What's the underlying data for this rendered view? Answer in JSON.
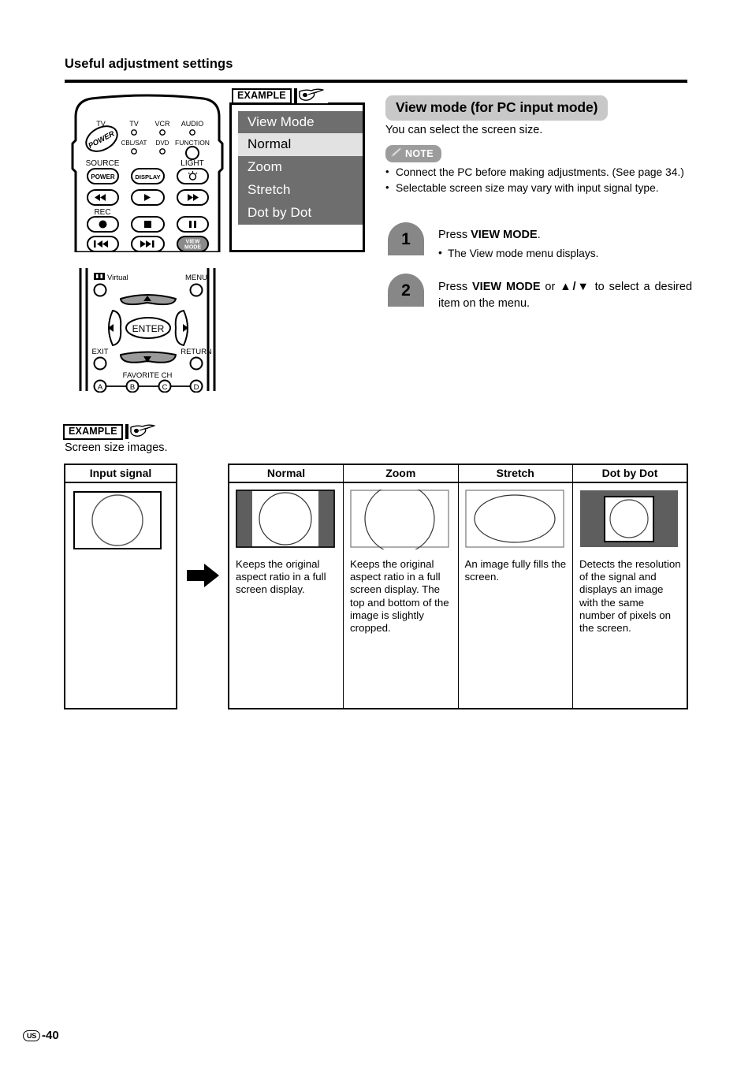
{
  "page": {
    "heading": "Useful adjustment settings",
    "footer_page": "-40",
    "footer_region": "US"
  },
  "example_top": {
    "label": "EXAMPLE",
    "icon": "pointing-hand-icon"
  },
  "view_mode_menu": {
    "title": "View Mode",
    "items": [
      {
        "label": "Normal",
        "selected": true
      },
      {
        "label": "Zoom",
        "selected": false
      },
      {
        "label": "Stretch",
        "selected": false
      },
      {
        "label": "Dot by Dot",
        "selected": false
      }
    ],
    "background_color": "#6e6e6e",
    "selected_color": "#e2e2e2"
  },
  "remote_top": {
    "labels": {
      "tv_power": "TV",
      "tv": "TV",
      "vcr": "VCR",
      "audio": "AUDIO",
      "cbl_sat": "CBL/SAT",
      "dvd": "DVD",
      "function": "FUNCTION",
      "source": "SOURCE",
      "light": "LIGHT",
      "rec": "REC",
      "power_button": "POWER",
      "display_button": "DISPLAY",
      "view_mode_button_line1": "VIEW",
      "view_mode_button_line2": "MODE",
      "power_dial": "POWER"
    }
  },
  "remote_bottom": {
    "labels": {
      "virtual": "Virtual",
      "menu": "MENU",
      "enter": "ENTER",
      "exit": "EXIT",
      "return": "RETURN",
      "favorite_ch": "FAVORITE CH",
      "a": "A",
      "b": "B",
      "c": "C",
      "d": "D"
    }
  },
  "section": {
    "title": "View mode (for PC input mode)",
    "title_bg": "#c8c8c8",
    "intro": "You can select the screen size.",
    "note_label": "NOTE",
    "note_icon": "pencil-icon",
    "notes": [
      "Connect the PC before making adjustments. (See page 34.)",
      "Selectable screen size may vary with input signal type."
    ]
  },
  "steps": [
    {
      "number": "1",
      "text_prefix": "Press ",
      "text_bold": "VIEW MODE",
      "text_suffix": ".",
      "sub": "The View mode menu displays."
    },
    {
      "number": "2",
      "text_prefix": "Press ",
      "text_bold": "VIEW MODE",
      "text_middle": " or ",
      "text_arrows": "▲/▼",
      "text_suffix": " to select a desired item on the menu."
    }
  ],
  "example_bottom": {
    "label": "EXAMPLE",
    "icon": "pointing-hand-icon",
    "caption": "Screen size images."
  },
  "input_table": {
    "header": "Input signal"
  },
  "mode_table": {
    "headers": [
      "Normal",
      "Zoom",
      "Stretch",
      "Dot by Dot"
    ],
    "descriptions": [
      "Keeps the original aspect ratio in a full screen display.",
      "Keeps the original aspect ratio in a full screen display. The top and bottom of the image is slightly cropped.",
      "An image fully fills the screen.",
      "Detects the resolution of the signal and displays an image with the same number of pixels on the screen."
    ]
  }
}
